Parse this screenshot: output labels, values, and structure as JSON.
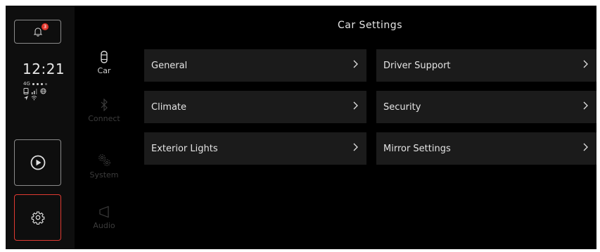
{
  "header": {
    "title": "Car Settings"
  },
  "notifications": {
    "badge_count": "3"
  },
  "status_bar": {
    "time": "12:21",
    "network": "4G"
  },
  "categories": [
    {
      "label": "Car",
      "icon": "car-icon",
      "active": true
    },
    {
      "label": "Connect",
      "icon": "bluetooth-icon",
      "active": false
    },
    {
      "label": "System",
      "icon": "gears-icon",
      "active": false
    },
    {
      "label": "Audio",
      "icon": "speaker-icon",
      "active": false
    }
  ],
  "settings": [
    {
      "label": "General"
    },
    {
      "label": "Driver Support"
    },
    {
      "label": "Climate"
    },
    {
      "label": "Security"
    },
    {
      "label": "Exterior Lights"
    },
    {
      "label": "Mirror Settings"
    }
  ],
  "colors": {
    "background": "#000000",
    "tile": "#1b1b1b",
    "accent_active": "#e03a32",
    "badge": "#e0352b"
  }
}
